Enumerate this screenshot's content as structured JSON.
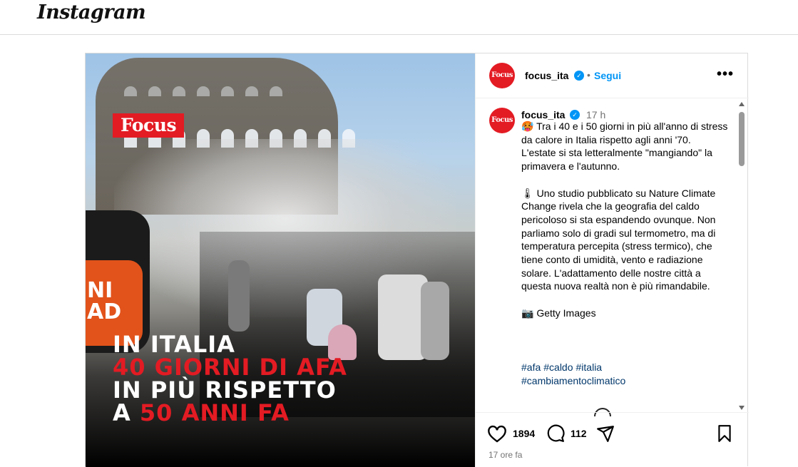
{
  "app": {
    "logo_text": "Instagram"
  },
  "media": {
    "brand_badge": "Focus",
    "mic_text_1": "NI",
    "mic_text_2": "AD",
    "headline": {
      "line1": "IN ITALIA",
      "line2": "40 GIORNI DI AFA",
      "line3": "IN PIÙ RISPETTO",
      "line4_prefix": "A ",
      "line4_highlight": "50 ANNI FA"
    },
    "colors": {
      "brand_red": "#e31b23",
      "link_blue": "#0095f6"
    }
  },
  "header": {
    "avatar_text": "Focus",
    "username": "focus_ita",
    "separator": "•",
    "follow_label": "Segui",
    "more_label": "•••"
  },
  "caption": {
    "avatar_text": "Focus",
    "username": "focus_ita",
    "time": "17 h",
    "text": "🥵 Tra i 40 e i 50 giorni in più all'anno di stress da calore in Italia rispetto agli anni '70. L'estate si sta letteralmente \"mangiando\" la primavera e l'autunno.\n\n🌡 Uno studio pubblicato su Nature Climate Change rivela che la geografia del caldo pericoloso si sta espandendo ovunque. Non parliamo solo di gradi sul termometro, ma di temperatura percepita (stress termico), che tiene conto di umidità, vento e radiazione solare. L'adattamento delle nostre città a questa nuova realtà non è più rimandabile.\n\n📷 Getty Images",
    "hashtags": [
      "#afa",
      "#caldo",
      "#italia",
      "#cambiamentoclimatico"
    ]
  },
  "actions": {
    "likes": "1894",
    "comments": "112",
    "posted_ago": "17 ore fa",
    "icons": [
      "heart-icon",
      "comment-icon",
      "share-icon",
      "bookmark-icon"
    ]
  }
}
